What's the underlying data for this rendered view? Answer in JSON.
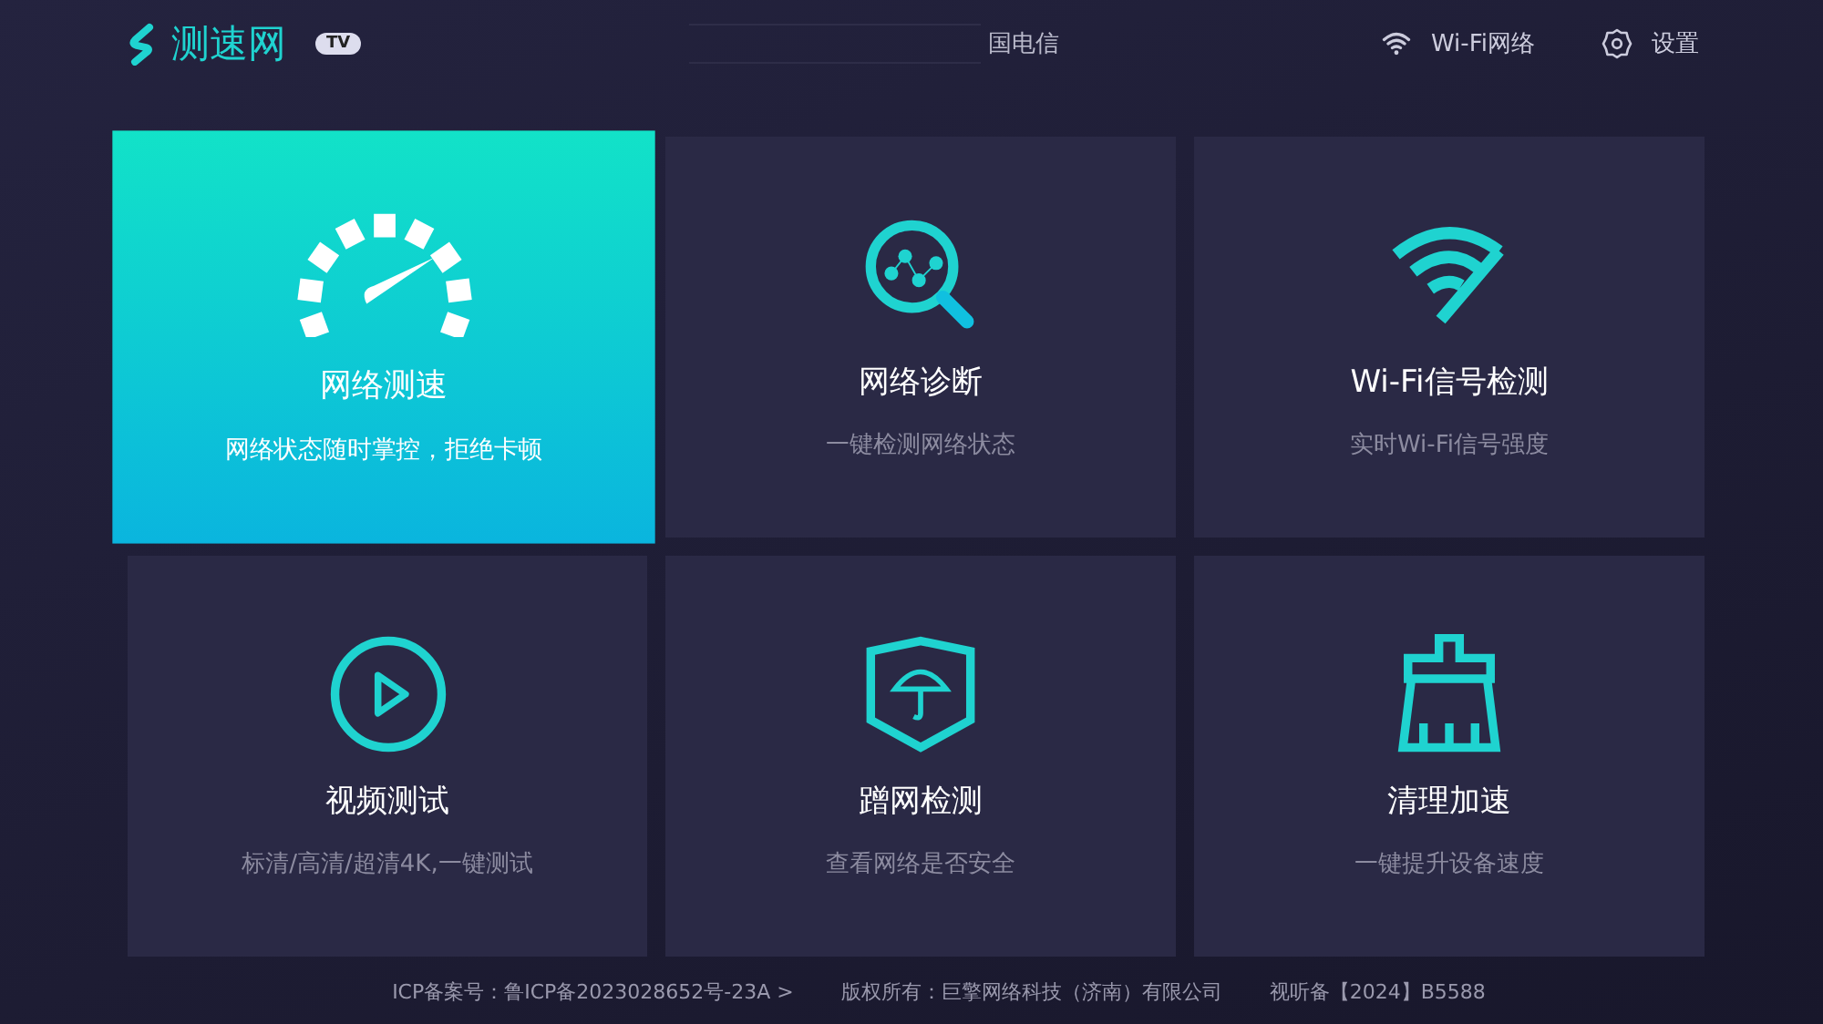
{
  "header": {
    "logo_text": "测速网",
    "logo_badge": "TV",
    "carrier": "国电信",
    "wifi_label": "Wi-Fi网络",
    "settings_label": "设置"
  },
  "tiles": [
    {
      "kind": "speed",
      "title": "网络测速",
      "subtitle": "网络状态随时掌控，拒绝卡顿",
      "selected": true
    },
    {
      "kind": "diagnose",
      "title": "网络诊断",
      "subtitle": "一键检测网络状态",
      "selected": false
    },
    {
      "kind": "wifi",
      "title": "Wi-Fi信号检测",
      "subtitle": "实时Wi-Fi信号强度",
      "selected": false
    },
    {
      "kind": "video",
      "title": "视频测试",
      "subtitle": "标清/高清/超清4K,一键测试",
      "selected": false
    },
    {
      "kind": "shield",
      "title": "蹭网检测",
      "subtitle": "查看网络是否安全",
      "selected": false
    },
    {
      "kind": "clean",
      "title": "清理加速",
      "subtitle": "一键提升设备速度",
      "selected": false
    }
  ],
  "footer": [
    "ICP备案号：鲁ICP备2023028652号-23A >",
    "版权所有：巨擎网络科技（济南）有限公司",
    "视听备【2024】B5588"
  ]
}
